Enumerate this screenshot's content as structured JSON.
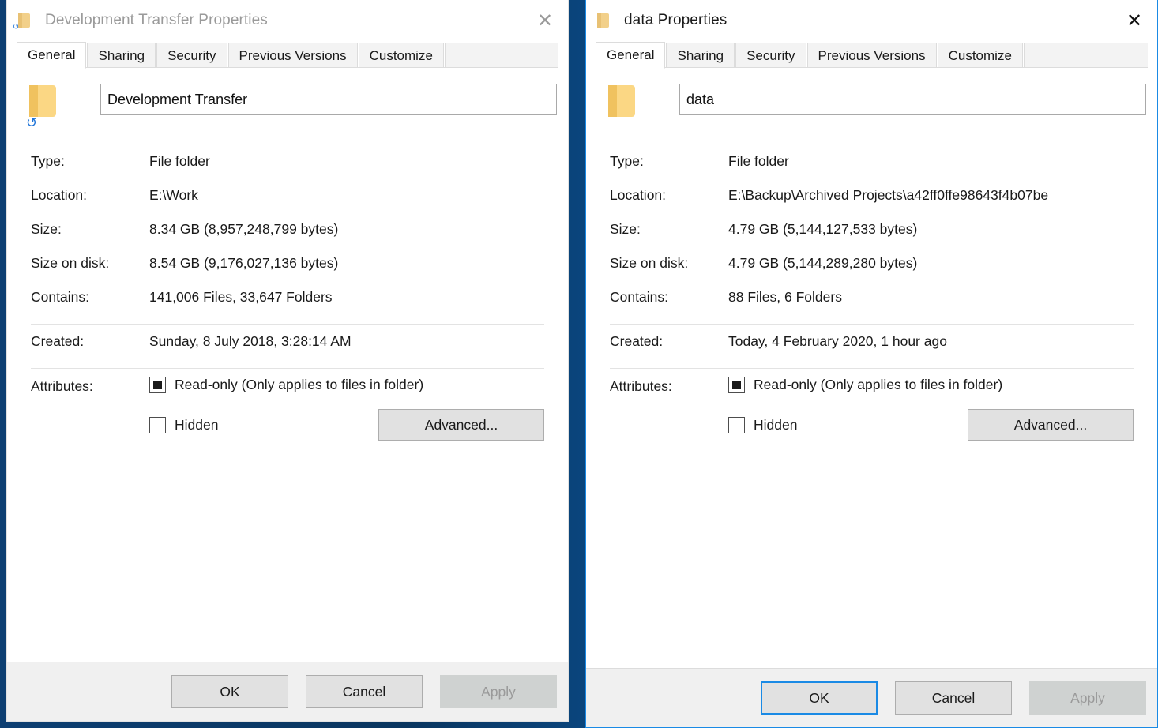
{
  "desktop": {
    "background_color": "#0d3f72",
    "accent_color": "#1a8ae5"
  },
  "windows": [
    {
      "id": "left",
      "state": "inactive",
      "title": "Development Transfer Properties",
      "title_icon": "folder-sync-icon",
      "close_label": "✕",
      "tabs": [
        {
          "label": "General",
          "active": true
        },
        {
          "label": "Sharing",
          "active": false
        },
        {
          "label": "Security",
          "active": false
        },
        {
          "label": "Previous Versions",
          "active": false
        },
        {
          "label": "Customize",
          "active": false
        }
      ],
      "name_field": {
        "value": "Development Transfer",
        "icon": "folder-sync-icon"
      },
      "details": [
        {
          "label": "Type:",
          "value": "File folder"
        },
        {
          "label": "Location:",
          "value": "E:\\Work"
        },
        {
          "label": "Size:",
          "value": "8.34 GB (8,957,248,799 bytes)"
        },
        {
          "label": "Size on disk:",
          "value": "8.54 GB (9,176,027,136 bytes)"
        },
        {
          "label": "Contains:",
          "value": "141,006 Files, 33,647 Folders"
        }
      ],
      "created": {
        "label": "Created:",
        "value": "Sunday, 8 July 2018, 3:28:14 AM"
      },
      "attributes": {
        "label": "Attributes:",
        "readonly_label": "Read-only (Only applies to files in folder)",
        "readonly_state": "indeterminate",
        "hidden_label": "Hidden",
        "hidden_state": "unchecked",
        "advanced_label": "Advanced..."
      },
      "footer": {
        "ok_label": "OK",
        "cancel_label": "Cancel",
        "apply_label": "Apply",
        "apply_disabled": true,
        "ok_focused": false
      }
    },
    {
      "id": "right",
      "state": "active",
      "title": "data Properties",
      "title_icon": "folder-icon",
      "close_label": "✕",
      "tabs": [
        {
          "label": "General",
          "active": true
        },
        {
          "label": "Sharing",
          "active": false
        },
        {
          "label": "Security",
          "active": false
        },
        {
          "label": "Previous Versions",
          "active": false
        },
        {
          "label": "Customize",
          "active": false
        }
      ],
      "name_field": {
        "value": "data",
        "icon": "folder-icon"
      },
      "details": [
        {
          "label": "Type:",
          "value": "File folder"
        },
        {
          "label": "Location:",
          "value": "E:\\Backup\\Archived Projects\\a42ff0ffe98643f4b07be"
        },
        {
          "label": "Size:",
          "value": "4.79 GB (5,144,127,533 bytes)"
        },
        {
          "label": "Size on disk:",
          "value": "4.79 GB (5,144,289,280 bytes)"
        },
        {
          "label": "Contains:",
          "value": "88 Files, 6 Folders"
        }
      ],
      "created": {
        "label": "Created:",
        "value": "Today, 4 February 2020, 1 hour ago"
      },
      "attributes": {
        "label": "Attributes:",
        "readonly_label": "Read-only (Only applies to files in folder)",
        "readonly_state": "indeterminate",
        "hidden_label": "Hidden",
        "hidden_state": "unchecked",
        "advanced_label": "Advanced..."
      },
      "footer": {
        "ok_label": "OK",
        "cancel_label": "Cancel",
        "apply_label": "Apply",
        "apply_disabled": true,
        "ok_focused": true
      }
    }
  ]
}
